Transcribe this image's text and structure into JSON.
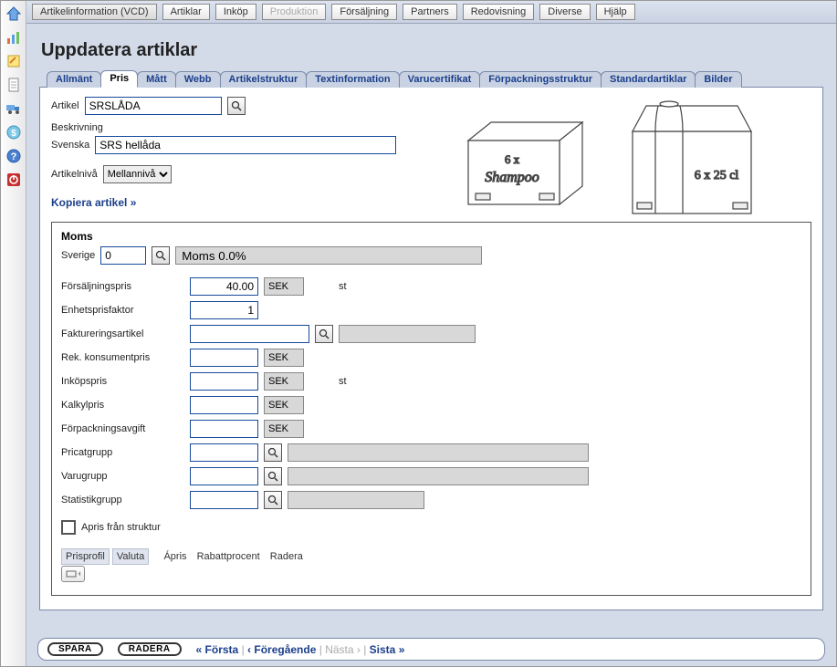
{
  "topnav": {
    "items": [
      {
        "label": "Artikelinformation (VCD)",
        "state": "active"
      },
      {
        "label": "Artiklar",
        "state": ""
      },
      {
        "label": "Inköp",
        "state": ""
      },
      {
        "label": "Produktion",
        "state": "disabled"
      },
      {
        "label": "Försäljning",
        "state": ""
      },
      {
        "label": "Partners",
        "state": ""
      },
      {
        "label": "Redovisning",
        "state": ""
      },
      {
        "label": "Diverse",
        "state": ""
      },
      {
        "label": "Hjälp",
        "state": ""
      }
    ]
  },
  "page_title": "Uppdatera artiklar",
  "tabs": [
    "Allmänt",
    "Pris",
    "Mått",
    "Webb",
    "Artikelstruktur",
    "Textinformation",
    "Varucertifikat",
    "Förpackningsstruktur",
    "Standardartiklar",
    "Bilder"
  ],
  "active_tab": "Pris",
  "article": {
    "label": "Artikel",
    "value": "SRSLÅDA"
  },
  "description": {
    "group": "Beskrivning",
    "lang": "Svenska",
    "value": "SRS hellåda"
  },
  "level": {
    "label": "Artikelnivå",
    "value": "Mellannivå"
  },
  "copy_link": "Kopiera artikel »",
  "moms": {
    "title": "Moms",
    "country": "Sverige",
    "code": "0",
    "display": "Moms 0.0%"
  },
  "price_rows": {
    "forsaljningspris": {
      "label": "Försäljningspris",
      "value": "40.00",
      "unit": "SEK",
      "suffix": "st"
    },
    "enhetsprisfaktor": {
      "label": "Enhetsprisfaktor",
      "value": "1"
    },
    "faktureringsartikel": {
      "label": "Faktureringsartikel",
      "value": "",
      "display": ""
    },
    "rek_konsumentpris": {
      "label": "Rek. konsumentpris",
      "value": "",
      "unit": "SEK"
    },
    "inkopspris": {
      "label": "Inköpspris",
      "value": "",
      "unit": "SEK",
      "suffix": "st"
    },
    "kalkylpris": {
      "label": "Kalkylpris",
      "value": "",
      "unit": "SEK"
    },
    "forpackningsavgift": {
      "label": "Förpackningsavgift",
      "value": "",
      "unit": "SEK"
    },
    "pricatgrupp": {
      "label": "Pricatgrupp",
      "value": "",
      "display": ""
    },
    "varugrupp": {
      "label": "Varugrupp",
      "value": "",
      "display": ""
    },
    "statistikgrupp": {
      "label": "Statistikgrupp",
      "value": "",
      "display": ""
    }
  },
  "apris_checkbox": {
    "label": "Apris från struktur",
    "checked": false
  },
  "profile_table": {
    "headers": [
      "Prisprofil",
      "Valuta",
      "Ápris",
      "Rabattprocent",
      "Radera"
    ]
  },
  "footer": {
    "save": "SPARA",
    "delete": "RADERA",
    "first": "« Första",
    "prev": "‹ Föregående",
    "next": "Nästa ›",
    "last": "Sista »",
    "sep": " | "
  },
  "sidebar_icons": [
    "home-icon",
    "chart-icon",
    "note-icon",
    "doc-icon",
    "truck-icon",
    "coin-icon",
    "help-icon",
    "power-icon"
  ]
}
